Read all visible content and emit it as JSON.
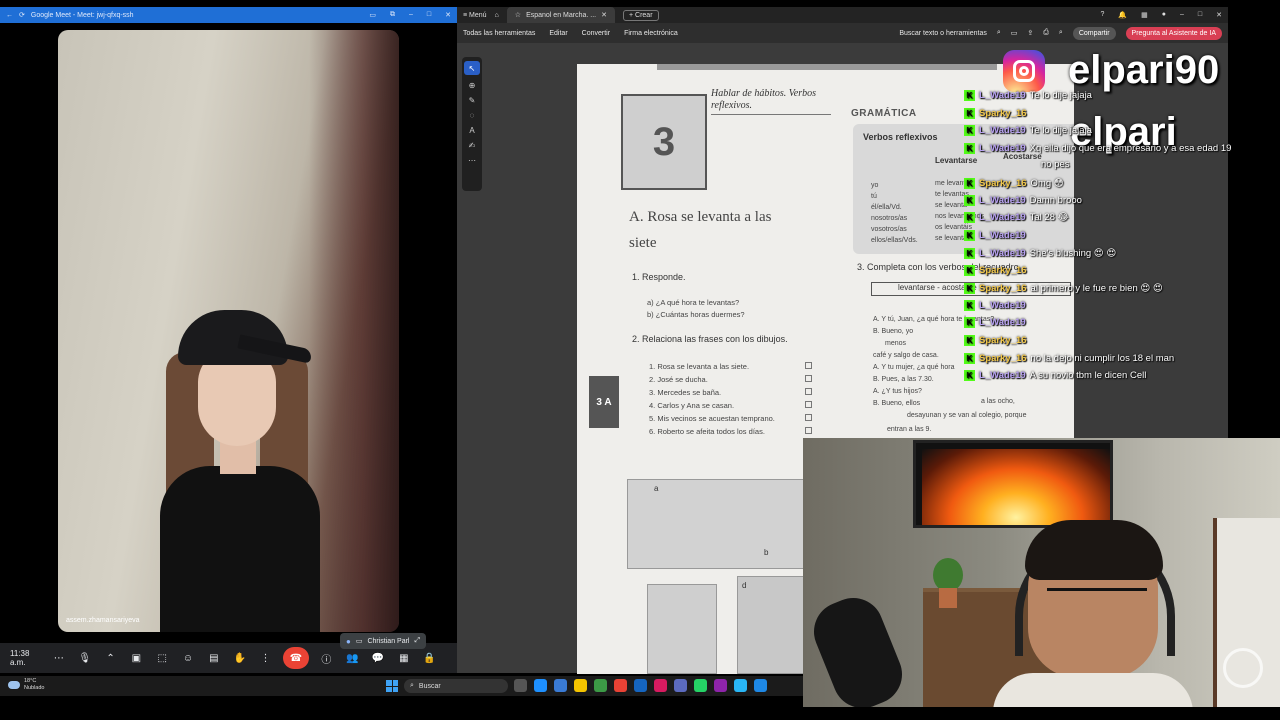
{
  "meet": {
    "tab_title": "Google Meet - Meet: jwj-qfxq-ssh",
    "participant_name": "assem.zhamansariyeva",
    "presenter_name": "Christian Parl",
    "time": "11:38 a.m.",
    "people_count": "2"
  },
  "pdf": {
    "menu_label": "Menú",
    "tab_title": "Espanol en Marcha. ...",
    "new_tab_label": "Crear",
    "menu_items": [
      "Todas las herramientas",
      "Editar",
      "Convertir",
      "Firma electrónica"
    ],
    "search_label": "Buscar texto o herramientas",
    "share_label": "Compartir",
    "ai_label": "Pregunta al Asistente de IA",
    "page": {
      "unit_number": "3",
      "habits_title": "Hablar de hábitos. Verbos reflexivos.",
      "lesson_title": "A. Rosa se levanta a las siete",
      "section1": "1. Responde.",
      "q_a": "a) ¿A qué hora te levantas?",
      "q_b": "b) ¿Cuántas horas duermes?",
      "section2": "2. Relaciona las frases con los dibujos.",
      "sentences": [
        "1. Rosa se levanta a las siete.",
        "2. José se ducha.",
        "3. Mercedes se baña.",
        "4. Carlos y Ana se casan.",
        "5. Mis vecinos se acuestan temprano.",
        "6. Roberto se afeita todos los días."
      ],
      "side_tab": "3 A",
      "grammar": "GRAMÁTICA",
      "verb_card_title": "Verbos reflexivos",
      "verb_col": "Levantarse",
      "verb_col2": "Acostarse",
      "pronouns": [
        "yo",
        "tú",
        "él/ella/Vd.",
        "nosotros/as",
        "vosotros/as",
        "ellos/ellas/Vds."
      ],
      "levanta_forms": [
        "me levanto",
        "te levantas",
        "se levanta",
        "nos levantamos",
        "os levantáis",
        "se levantan"
      ],
      "section3": "3. Completa con los verbos del recuadro.",
      "box_text": "levantarse - acostarse",
      "dialog": [
        "A. Y tú, Juan, ¿a qué hora te levantas?",
        "B. Bueno, yo",
        "menos",
        "café y salgo de casa.",
        "A. Y tu mujer, ¿a qué hora",
        "B. Pues, a las 7.30.",
        "A. ¿Y tus hijos?",
        "B. Bueno, ellos",
        "desayunan y se van al colegio, porque",
        "entran a las 9."
      ],
      "a_las_ocho": "a las ocho,",
      "pic_labels": [
        "a",
        "b",
        "d"
      ]
    }
  },
  "overlay": {
    "handle_top": "elpari90",
    "handle_bottom": "elpari"
  },
  "chat": [
    {
      "user": "L_Wade19",
      "text": "Te lo dije jajaja",
      "alt": false
    },
    {
      "user": "Sparky_16",
      "text": "",
      "alt": true
    },
    {
      "user": "L_Wade19",
      "text": "Te lo dije jajaja",
      "alt": false
    },
    {
      "user": "L_Wade19",
      "text": "Xq ella dijo que era empresario y a esa edad 19",
      "alt": false
    },
    {
      "user": "",
      "text": "no pes",
      "alt": false
    },
    {
      "user": "Sparky_16",
      "text": "Omg 😳",
      "alt": true
    },
    {
      "user": "L_Wade19",
      "text": "Damn brooo",
      "alt": false
    },
    {
      "user": "L_Wade19",
      "text": "Tal 28 😂",
      "alt": false
    },
    {
      "user": "L_Wade19",
      "text": "",
      "alt": false
    },
    {
      "user": "L_Wade19",
      "text": "She's blushing 😍 😍",
      "alt": false
    },
    {
      "user": "Sparky_16",
      "text": "",
      "alt": true
    },
    {
      "user": "Sparky_16",
      "text": "al primero y le fue re bien 😍 😍",
      "alt": true
    },
    {
      "user": "L_Wade19",
      "text": "",
      "alt": false
    },
    {
      "user": "L_Wade19",
      "text": "",
      "alt": false
    },
    {
      "user": "Sparky_16",
      "text": "",
      "alt": true
    },
    {
      "user": "Sparky_16",
      "text": "no la dejo ni cumplir los 18 el man",
      "alt": true
    },
    {
      "user": "L_Wade19",
      "text": "A su novio tbm le dicen Cell",
      "alt": false
    }
  ],
  "taskbar": {
    "temp": "18°C",
    "condition": "Nublado",
    "search_label": "Buscar"
  }
}
